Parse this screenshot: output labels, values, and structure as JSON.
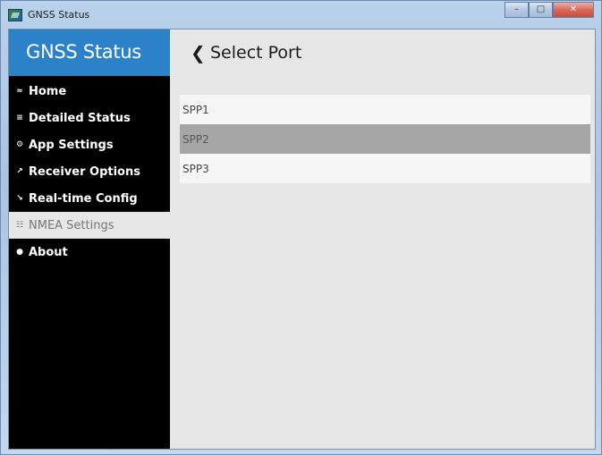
{
  "window": {
    "title": "GNSS Status",
    "minimize_glyph": "–",
    "maximize_glyph": "□",
    "close_glyph": "✕"
  },
  "sidebar": {
    "title": "GNSS Status",
    "items": [
      {
        "label": "Home",
        "icon": "home-icon",
        "glyph": "≈",
        "active": false
      },
      {
        "label": "Detailed Status",
        "icon": "chart-icon",
        "glyph": "≡",
        "active": false
      },
      {
        "label": "App Settings",
        "icon": "gear-icon",
        "glyph": "⚙",
        "active": false
      },
      {
        "label": "Receiver Options",
        "icon": "wrench-icon",
        "glyph": "↗",
        "active": false
      },
      {
        "label": "Real-time Config",
        "icon": "signal-icon",
        "glyph": "↘",
        "active": false
      },
      {
        "label": "NMEA Settings",
        "icon": "sliders-icon",
        "glyph": "☷",
        "active": true
      },
      {
        "label": "About",
        "icon": "info-icon",
        "glyph": "●",
        "active": false
      }
    ]
  },
  "main": {
    "back_glyph": "❮",
    "title": "Select Port",
    "ports": [
      {
        "label": "SPP1",
        "selected": false
      },
      {
        "label": "SPP2",
        "selected": true
      },
      {
        "label": "SPP3",
        "selected": false
      }
    ]
  },
  "colors": {
    "sidebar_header": "#2b82c9",
    "sidebar_bg": "#000000",
    "content_bg": "#e6e6e6",
    "selected_item": "#a6a6a6",
    "item_bg": "#f6f6f6"
  }
}
